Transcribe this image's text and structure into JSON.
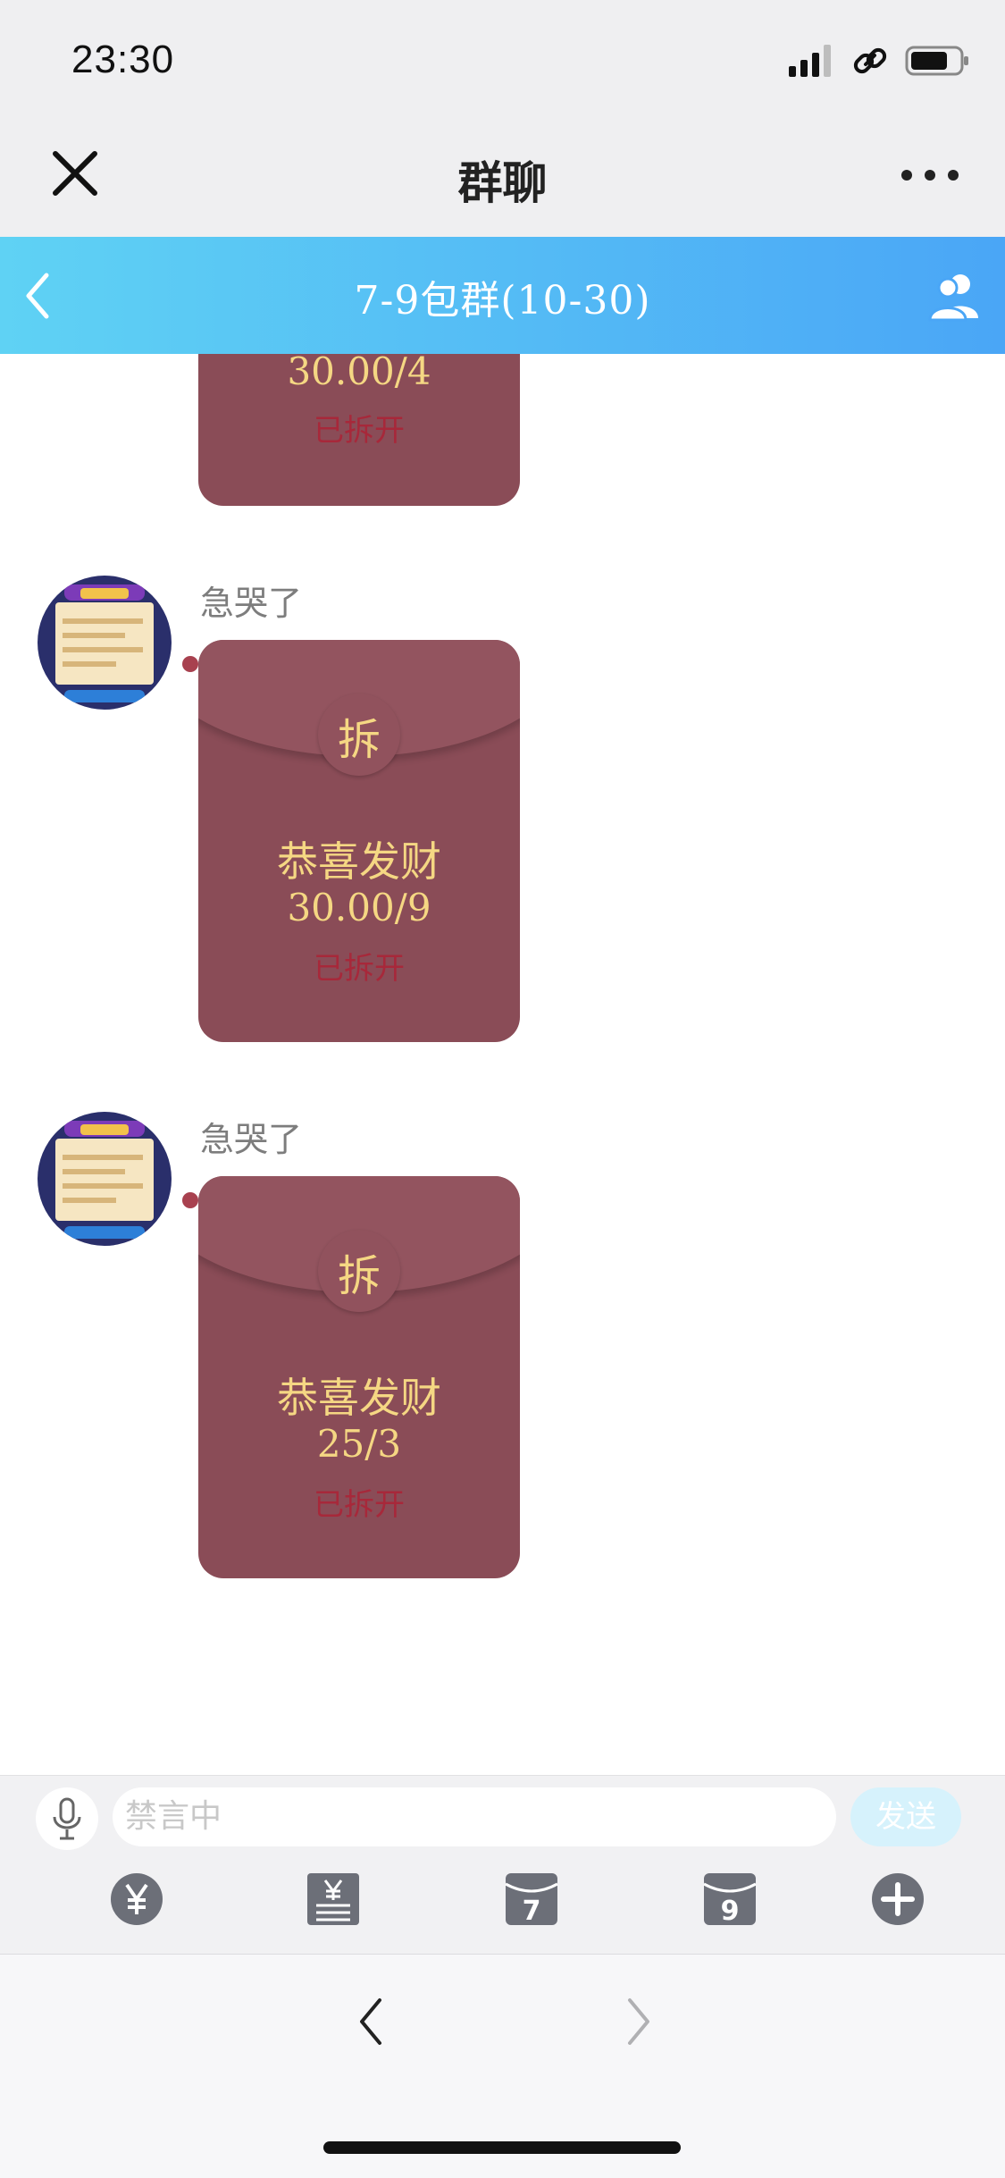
{
  "status_bar": {
    "time": "23:30"
  },
  "header": {
    "title": "群聊"
  },
  "group_bar": {
    "title": "7-9包群(10-30)"
  },
  "messages": [
    {
      "amount": "30.00/4",
      "status": "已拆开"
    },
    {
      "sender": "急哭了",
      "seal": "拆",
      "blessing": "恭喜发财",
      "amount": "30.00/9",
      "status": "已拆开"
    },
    {
      "sender": "急哭了",
      "seal": "拆",
      "blessing": "恭喜发财",
      "amount": "25/3",
      "status": "已拆开"
    }
  ],
  "input_bar": {
    "placeholder": "禁言中",
    "send_label": "发送"
  },
  "toolbar": {
    "icons": [
      "yuan-coin-icon",
      "money-list-icon",
      "packet-7-icon",
      "packet-9-icon",
      "plus-circle-icon"
    ],
    "packet_7": "7",
    "packet_9": "9"
  },
  "colors": {
    "accent_start": "#5fd2f4",
    "accent_end": "#4aa6f6",
    "envelope": "#8a4c57",
    "envelope_text": "#f5d783",
    "opened": "#a7283a"
  }
}
